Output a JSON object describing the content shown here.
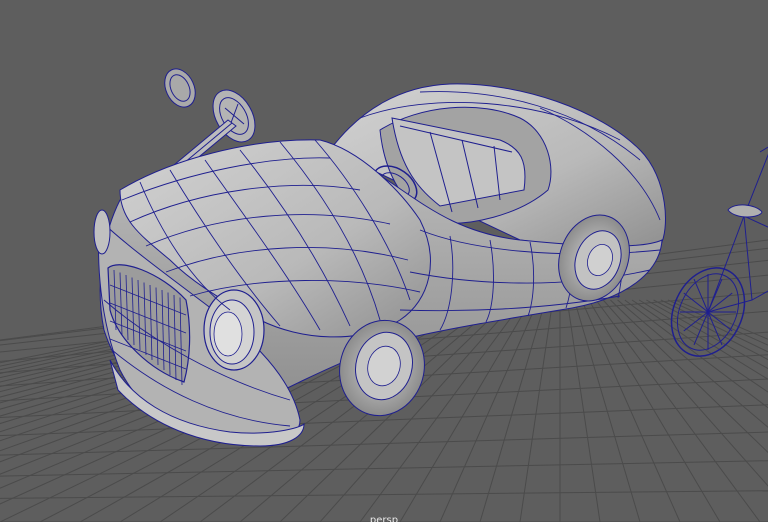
{
  "viewport": {
    "camera_label": "persp"
  },
  "scene": {
    "objects": [
      "car",
      "steering-wheel",
      "bicycle"
    ]
  },
  "colors": {
    "background": "#5e5e5e",
    "grid_line": "#4a4a4a",
    "mesh_fill": "#bdbdbd",
    "mesh_shade": "#9e9e9e",
    "wireframe": "#1f1f8f",
    "label": "#e8e8e8"
  }
}
